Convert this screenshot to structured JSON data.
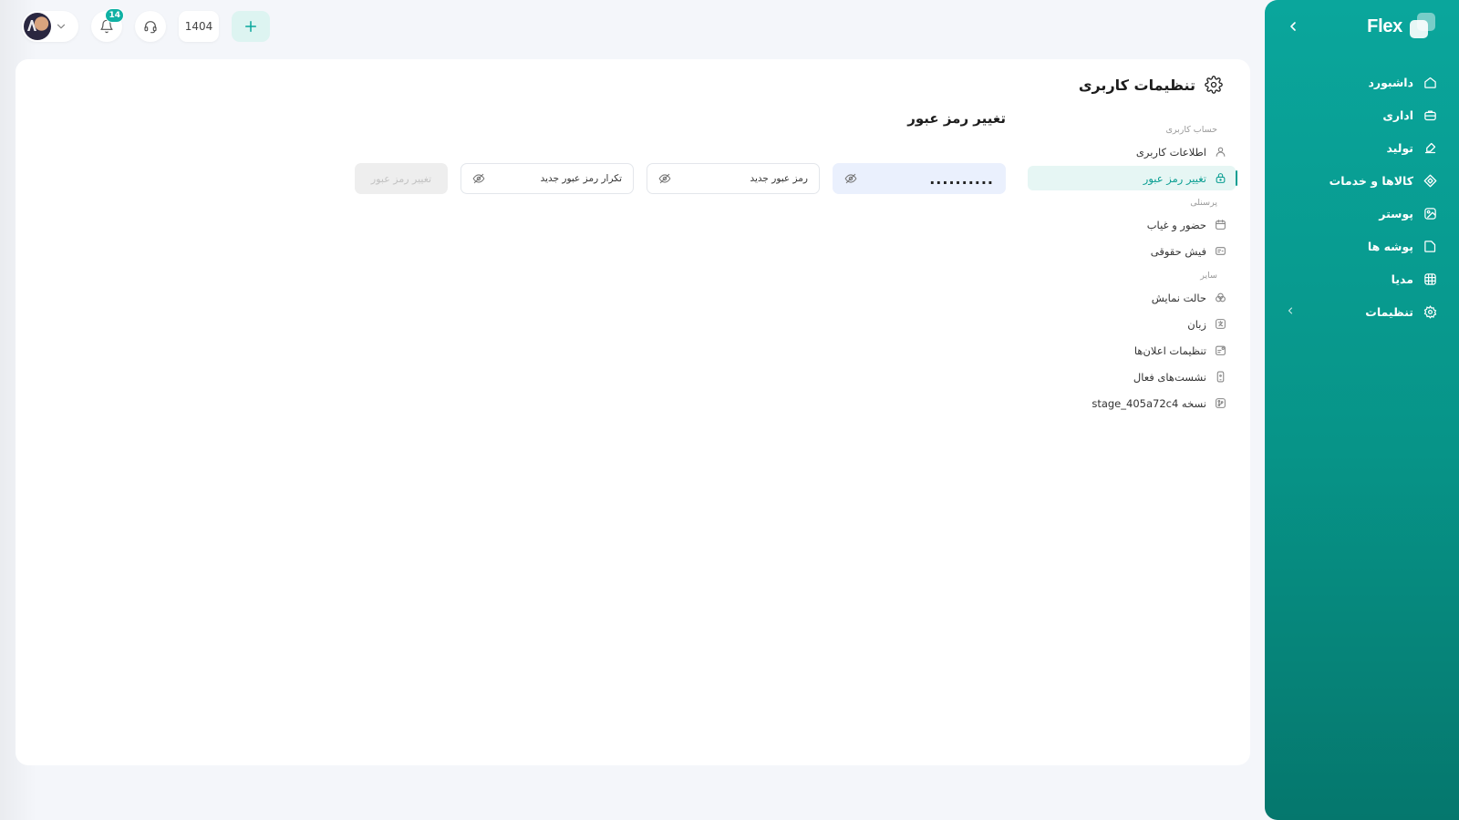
{
  "brand": {
    "name": "Flex"
  },
  "sidebar": {
    "items": [
      {
        "label": "داشبورد",
        "icon": "home-icon"
      },
      {
        "label": "اداری",
        "icon": "briefcase-icon"
      },
      {
        "label": "تولید",
        "icon": "production-icon"
      },
      {
        "label": "کالاها و خدمات",
        "icon": "products-icon"
      },
      {
        "label": "پوستر",
        "icon": "poster-icon"
      },
      {
        "label": "پوشه ها",
        "icon": "folder-icon"
      },
      {
        "label": "مدیا",
        "icon": "media-icon"
      },
      {
        "label": "تنظیمات",
        "icon": "gear-icon",
        "has_submenu": true
      }
    ]
  },
  "topbar": {
    "notifications_count": "14",
    "year": "1404"
  },
  "page": {
    "title": "تنظیمات کاربری"
  },
  "settings_menu": {
    "sections": [
      {
        "title": "حساب کاربری",
        "items": [
          {
            "label": "اطلاعات کاربری",
            "icon": "user-icon",
            "active": false
          },
          {
            "label": "تغییر رمز عبور",
            "icon": "lock-icon",
            "active": true
          }
        ]
      },
      {
        "title": "پرسنلی",
        "items": [
          {
            "label": "حضور و غیاب",
            "icon": "calendar-icon",
            "active": false
          },
          {
            "label": "فیش حقوقی",
            "icon": "payslip-icon",
            "active": false
          }
        ]
      },
      {
        "title": "سایر",
        "items": [
          {
            "label": "حالت نمایش",
            "icon": "palette-icon",
            "active": false
          },
          {
            "label": "زبان",
            "icon": "language-icon",
            "active": false
          },
          {
            "label": "تنظیمات اعلان‌ها",
            "icon": "notification-settings-icon",
            "active": false
          },
          {
            "label": "نشست‌های فعال",
            "icon": "device-icon",
            "active": false
          },
          {
            "label": "نسخه stage_405a72c4",
            "icon": "version-icon",
            "active": false
          }
        ]
      }
    ]
  },
  "change_password": {
    "title": "تغییر رمز عبور",
    "current_password_value": "..........",
    "new_password_placeholder": "رمز عبور جدید",
    "repeat_password_placeholder": "تکرار رمز عبور جدید",
    "submit_label": "تغییر رمز عبور"
  },
  "colors": {
    "accent": "#0aa69c",
    "accent_dark": "#05776d",
    "active_bg": "#e6f6f4",
    "filled_input_bg": "#eaf0fd",
    "disabled_button_bg": "#eeeeee"
  }
}
